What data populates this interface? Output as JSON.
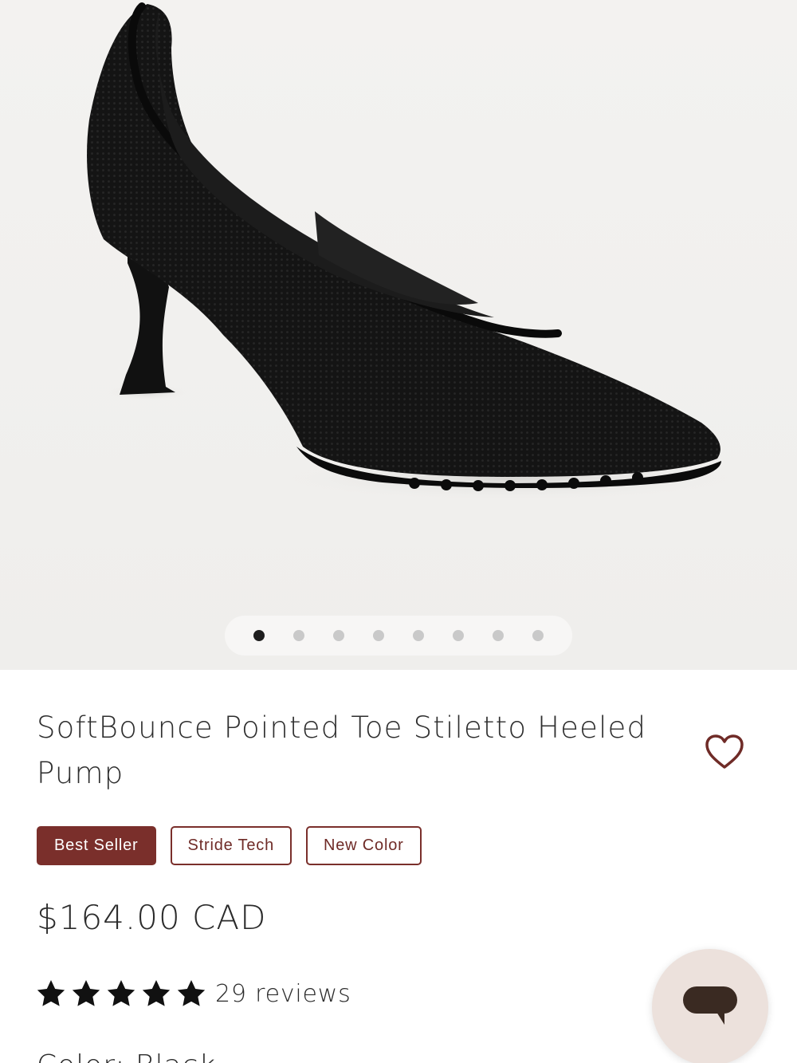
{
  "hero": {
    "image_alt": "SoftBounce Pointed Toe Stiletto Heeled Pump",
    "carousel": {
      "total": 8,
      "active_index": 0
    }
  },
  "product": {
    "title": "SoftBounce Pointed Toe Stiletto Heeled Pump",
    "wishlist_icon": "heart-outline-icon",
    "badges": [
      {
        "label": "Best Seller",
        "style": "solid"
      },
      {
        "label": "Stride Tech",
        "style": "outline"
      },
      {
        "label": "New Color",
        "style": "outline"
      }
    ],
    "price": "$164.00 CAD",
    "rating": {
      "stars": 5,
      "max": 5,
      "reviews_label": "29 reviews"
    },
    "color_label": "Color: Black"
  },
  "chat": {
    "icon": "chat-bubble-icon"
  },
  "colors": {
    "accent": "#7a2f2b",
    "hero_bg": "#f0efed",
    "chat_bg": "#ece1dc",
    "chat_icon": "#3a2a22",
    "star": "#111111"
  }
}
